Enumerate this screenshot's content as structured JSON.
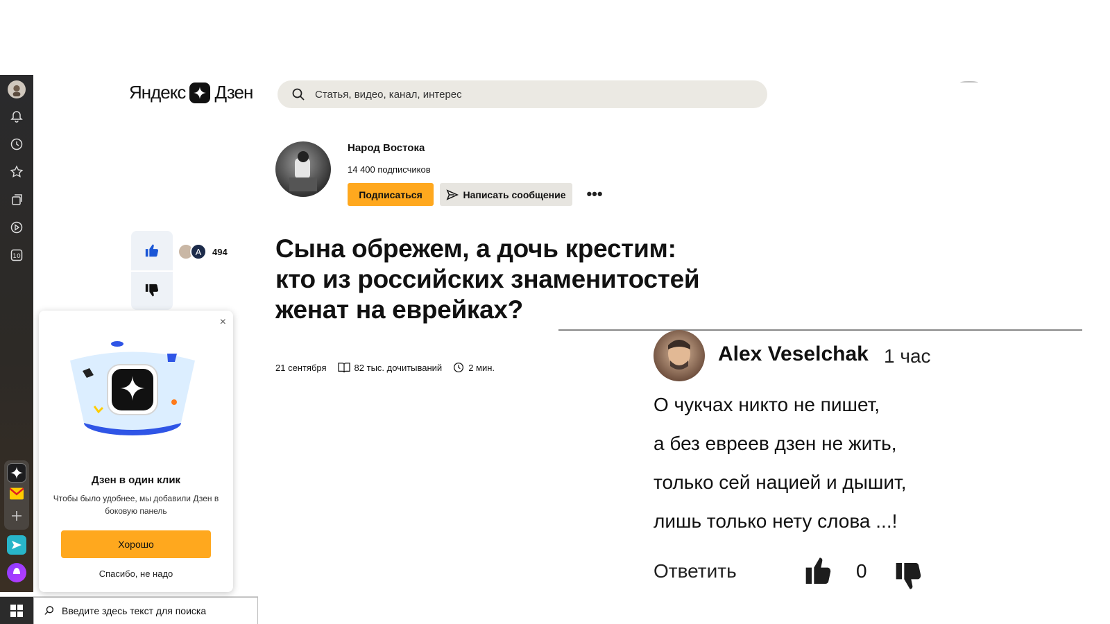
{
  "logo": {
    "left": "Яндекс",
    "right": "Дзен"
  },
  "search": {
    "placeholder": "Статья, видео, канал, интерес"
  },
  "channel": {
    "name": "Народ Востока",
    "subscribers": "14 400 подписчиков",
    "subscribe_label": "Подписаться",
    "message_label": "Написать сообщение",
    "more_label": "•••"
  },
  "reactions": {
    "liker_initial": "A",
    "likes_count": "494"
  },
  "article": {
    "title": "Сына обрежем, а дочь крестим: кто из российских знаменитостей женат на еврейках?",
    "date": "21 сентября",
    "reads": "82 тыс. дочитываний",
    "read_time": "2 мин."
  },
  "popup": {
    "close": "×",
    "title": "Дзен в один клик",
    "text": "Чтобы было удобнее, мы добавили Дзен в боковую панель",
    "ok_label": "Хорошо",
    "no_label": "Спасибо, не надо"
  },
  "comment": {
    "author": "Alex Veselchak",
    "time": "1 час",
    "lines": [
      "О чукчах никто не пишет,",
      "а без евреев дзен не жить,",
      "только сей нацией и дышит,",
      "лишь только нету слова ...!"
    ],
    "reply_label": "Ответить",
    "like_count": "0"
  },
  "taskbar": {
    "search_placeholder": "Введите здесь текст для поиска"
  },
  "sidebar_icons": [
    "profile-avatar",
    "bell-icon",
    "clock-icon",
    "star-icon",
    "collections-icon",
    "play-icon",
    "ten-icon",
    "zen-icon",
    "mail-icon",
    "plus-icon",
    "messenger-icon",
    "alice-icon"
  ],
  "colors": {
    "accent": "#ffa81e",
    "like_blue": "#1a56d6",
    "search_bg": "#ebe9e3"
  }
}
